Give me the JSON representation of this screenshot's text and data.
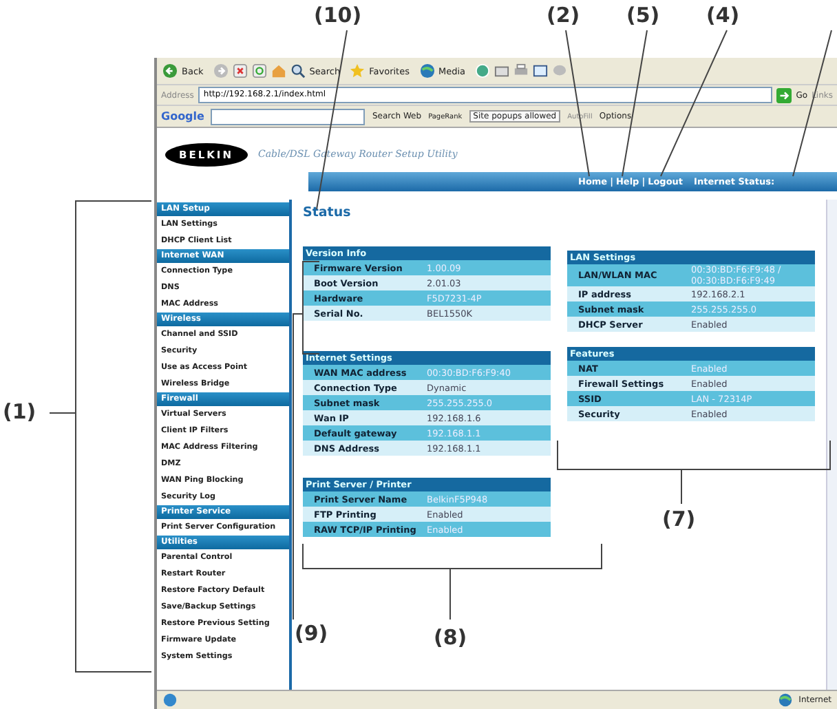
{
  "callouts": [
    "(10)",
    "(2)",
    "(5)",
    "(4)",
    "(1)",
    "(9)",
    "(8)",
    "(7)"
  ],
  "browser": {
    "toolbar": [
      "Back",
      "Search",
      "Favorites",
      "Media"
    ],
    "address": {
      "label": "Address",
      "value": "http://192.168.2.1/index.html",
      "go": "Go",
      "links": "Links"
    },
    "google_bar": {
      "logo": "Google",
      "search": "Search Web",
      "pagerank": "PageRank",
      "popups": "Site popups allowed",
      "autofill": "AutoFill",
      "options": "Options"
    },
    "status_bar": "Internet"
  },
  "header": {
    "logo": "BELKIN",
    "subtitle": "Cable/DSL Gateway Router Setup Utility",
    "links": [
      "Home",
      "Help",
      "Logout"
    ],
    "link_separator": "|",
    "internet_status": "Internet Status:"
  },
  "sidebar": {
    "sections": [
      {
        "title": "LAN Setup",
        "items": [
          "LAN Settings",
          "DHCP Client List"
        ]
      },
      {
        "title": "Internet WAN",
        "items": [
          "Connection Type",
          "DNS",
          "MAC Address"
        ]
      },
      {
        "title": "Wireless",
        "items": [
          "Channel and SSID",
          "Security",
          "Use as Access Point",
          "Wireless Bridge"
        ]
      },
      {
        "title": "Firewall",
        "items": [
          "Virtual Servers",
          "Client IP Filters",
          "MAC Address Filtering",
          "DMZ",
          "WAN Ping Blocking",
          "Security Log"
        ]
      },
      {
        "title": "Printer Service",
        "items": [
          "Print Server Configuration"
        ]
      },
      {
        "title": "Utilities",
        "items": [
          "Parental Control",
          "Restart Router",
          "Restore Factory Default",
          "Save/Backup Settings",
          "Restore Previous Setting",
          "Firmware Update",
          "System Settings"
        ]
      }
    ]
  },
  "page_title": "Status",
  "left_panels": [
    {
      "title": "Version Info",
      "rows": [
        [
          "Firmware Version",
          "1.00.09"
        ],
        [
          "Boot Version",
          "2.01.03"
        ],
        [
          "Hardware",
          "F5D7231-4P"
        ],
        [
          "Serial No.",
          "BEL1550K"
        ]
      ]
    },
    {
      "title": "Internet Settings",
      "rows": [
        [
          "WAN MAC address",
          "00:30:BD:F6:F9:40"
        ],
        [
          "Connection Type",
          "Dynamic"
        ],
        [
          "Subnet mask",
          "255.255.255.0"
        ],
        [
          "Wan IP",
          "192.168.1.6"
        ],
        [
          "Default gateway",
          "192.168.1.1"
        ],
        [
          "DNS Address",
          "192.168.1.1"
        ]
      ]
    },
    {
      "title": "Print Server / Printer",
      "rows": [
        [
          "Print Server Name",
          "BelkinF5P948"
        ],
        [
          "FTP Printing",
          "Enabled"
        ],
        [
          "RAW TCP/IP Printing",
          "Enabled"
        ]
      ]
    }
  ],
  "right_panels": [
    {
      "title": "LAN Settings",
      "rows": [
        [
          "LAN/WLAN MAC",
          "00:30:BD:F6:F9:48 / 00:30:BD:F6:F9:49"
        ],
        [
          "IP address",
          "192.168.2.1"
        ],
        [
          "Subnet mask",
          "255.255.255.0"
        ],
        [
          "DHCP Server",
          "Enabled"
        ]
      ]
    },
    {
      "title": "Features",
      "rows": [
        [
          "NAT",
          "Enabled"
        ],
        [
          "Firewall Settings",
          "Enabled"
        ],
        [
          "SSID",
          "LAN - 72314P"
        ],
        [
          "Security",
          "Enabled"
        ]
      ]
    }
  ]
}
